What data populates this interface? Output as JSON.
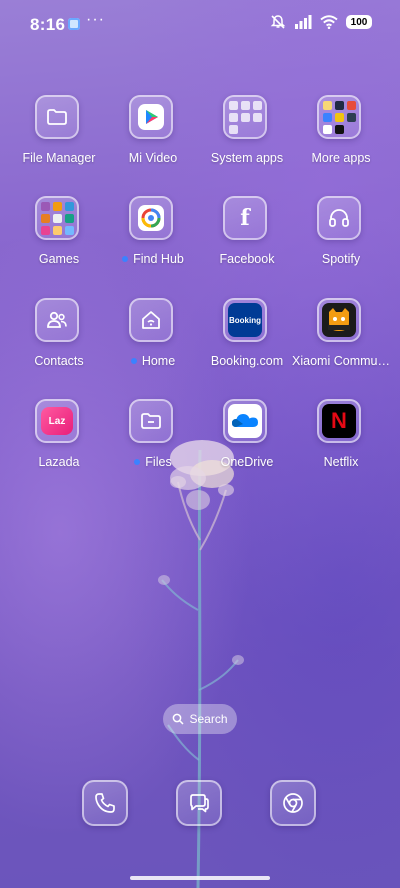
{
  "status_bar": {
    "time": "8:16",
    "more": "···",
    "battery": "100",
    "icons": [
      "notification-app-icon",
      "mute-icon",
      "signal-icon",
      "wifi-icon",
      "battery-icon"
    ]
  },
  "apps": [
    {
      "label": "File Manager",
      "icon": "folder-icon",
      "badge": false
    },
    {
      "label": "Mi Video",
      "icon": "play-icon",
      "badge": false
    },
    {
      "label": "System apps",
      "icon": "folder-group-icon",
      "badge": false
    },
    {
      "label": "More apps",
      "icon": "folder-group-icon",
      "badge": false
    },
    {
      "label": "Games",
      "icon": "folder-group-icon",
      "badge": false
    },
    {
      "label": "Find Hub",
      "icon": "find-hub-icon",
      "badge": true
    },
    {
      "label": "Facebook",
      "icon": "facebook-icon",
      "badge": false
    },
    {
      "label": "Spotify",
      "icon": "headphones-icon",
      "badge": false
    },
    {
      "label": "Contacts",
      "icon": "contacts-icon",
      "badge": false
    },
    {
      "label": "Home",
      "icon": "home-wifi-icon",
      "badge": true
    },
    {
      "label": "Booking.com",
      "icon": "booking-icon",
      "badge": false
    },
    {
      "label": "Xiaomi Commu…",
      "icon": "xiaomi-community-icon",
      "badge": false
    },
    {
      "label": "Lazada",
      "icon": "lazada-icon",
      "badge": false
    },
    {
      "label": "Files",
      "icon": "files-icon",
      "badge": true
    },
    {
      "label": "OneDrive",
      "icon": "cloud-icon",
      "badge": false
    },
    {
      "label": "Netflix",
      "icon": "netflix-icon",
      "badge": false
    }
  ],
  "icon_text": {
    "booking": "Booking",
    "lazada": "Laz",
    "netflix": "N",
    "facebook": "f"
  },
  "search": {
    "label": "Search"
  },
  "dock": [
    {
      "icon": "phone-icon"
    },
    {
      "icon": "messages-icon"
    },
    {
      "icon": "chrome-icon"
    }
  ],
  "colors": {
    "badge": "#3b82ff",
    "booking_bg": "#003b95",
    "netflix_bg": "#000000",
    "netflix_red": "#e50914",
    "lazada_pink": "#e91e7a"
  }
}
